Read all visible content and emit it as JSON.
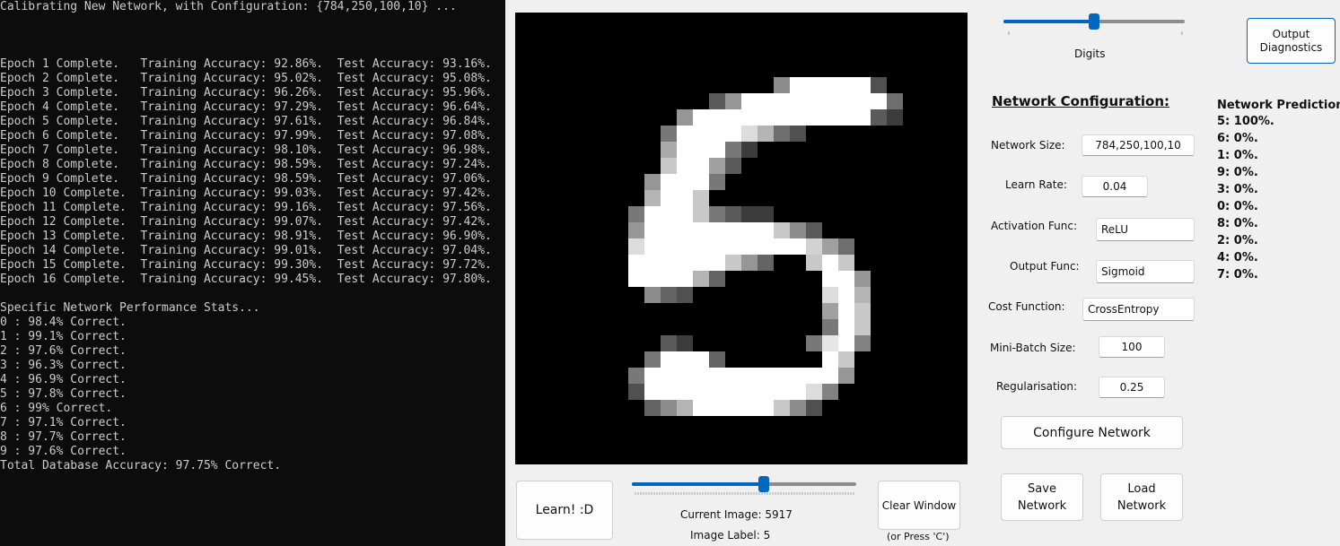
{
  "console": {
    "lines": [
      "Calibrating New Network, with Configuration: {784,250,100,10} ...",
      "",
      "",
      "",
      "Epoch 1 Complete.   Training Accuracy: 92.86%.  Test Accuracy: 93.16%.",
      "Epoch 2 Complete.   Training Accuracy: 95.02%.  Test Accuracy: 95.08%.",
      "Epoch 3 Complete.   Training Accuracy: 96.26%.  Test Accuracy: 95.96%.",
      "Epoch 4 Complete.   Training Accuracy: 97.29%.  Test Accuracy: 96.64%.",
      "Epoch 5 Complete.   Training Accuracy: 97.61%.  Test Accuracy: 96.84%.",
      "Epoch 6 Complete.   Training Accuracy: 97.99%.  Test Accuracy: 97.08%.",
      "Epoch 7 Complete.   Training Accuracy: 98.10%.  Test Accuracy: 96.98%.",
      "Epoch 8 Complete.   Training Accuracy: 98.59%.  Test Accuracy: 97.24%.",
      "Epoch 9 Complete.   Training Accuracy: 98.59%.  Test Accuracy: 97.06%.",
      "Epoch 10 Complete.  Training Accuracy: 99.03%.  Test Accuracy: 97.42%.",
      "Epoch 11 Complete.  Training Accuracy: 99.16%.  Test Accuracy: 97.56%.",
      "Epoch 12 Complete.  Training Accuracy: 99.07%.  Test Accuracy: 97.42%.",
      "Epoch 13 Complete.  Training Accuracy: 98.91%.  Test Accuracy: 96.90%.",
      "Epoch 14 Complete.  Training Accuracy: 99.01%.  Test Accuracy: 97.04%.",
      "Epoch 15 Complete.  Training Accuracy: 99.30%.  Test Accuracy: 97.72%.",
      "Epoch 16 Complete.  Training Accuracy: 99.45%.  Test Accuracy: 97.80%.",
      "",
      "Specific Network Performance Stats...",
      "0 : 98.4% Correct.",
      "1 : 99.1% Correct.",
      "2 : 97.6% Correct.",
      "3 : 96.3% Correct.",
      "4 : 96.9% Correct.",
      "5 : 97.8% Correct.",
      "6 : 99% Correct.",
      "7 : 97.1% Correct.",
      "8 : 97.7% Correct.",
      "9 : 97.6% Correct.",
      "Total Database Accuracy: 97.75% Correct."
    ]
  },
  "digit_image": {
    "grid_size": 28,
    "background": "#000000",
    "foreground": "#ffffff"
  },
  "digits_slider": {
    "label": "Digits",
    "value_fraction": 0.5
  },
  "output_diagnostics_label": "Output\nDiagnostics",
  "config": {
    "title": "Network Configuration:",
    "network_size": {
      "label": "Network Size:",
      "value": "784,250,100,10"
    },
    "learn_rate": {
      "label": "Learn Rate:",
      "value": "0.04"
    },
    "activation": {
      "label": "Activation Func:",
      "value": "ReLU"
    },
    "output_func": {
      "label": "Output Func:",
      "value": "Sigmoid"
    },
    "cost": {
      "label": "Cost Function:",
      "value": "CrossEntropy"
    },
    "mini_batch": {
      "label": "Mini-Batch Size:",
      "value": "100"
    },
    "regularisation": {
      "label": "Regularisation:",
      "value": "0.25"
    },
    "configure_button": "Configure Network"
  },
  "prediction": {
    "title": "Network Prediction:",
    "items": [
      "5: 100%.",
      "6: 0%.",
      "1: 0%.",
      "9: 0%.",
      "3: 0%.",
      "0: 0%.",
      "8: 0%.",
      "2: 0%.",
      "4: 0%.",
      "7: 0%."
    ]
  },
  "buttons": {
    "learn": "Learn! :D",
    "clear": "Clear Window",
    "clear_hint": "(or Press 'C')",
    "save": "Save\nNetwork",
    "load": "Load\nNetwork"
  },
  "image_slider": {
    "value_fraction": 0.6
  },
  "status": {
    "current_image": "Current Image: 5917",
    "image_label": "Image Label: 5"
  },
  "colors": {
    "accent": "#0067c0",
    "console_bg": "#0c0c0c",
    "console_text": "#cccccc"
  }
}
